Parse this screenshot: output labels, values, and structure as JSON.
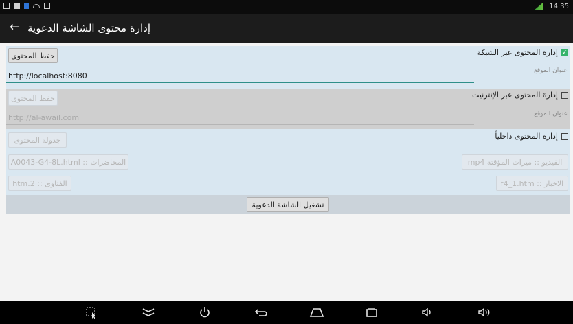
{
  "status_bar": {
    "time": "14:35"
  },
  "header": {
    "back": "←",
    "title": "إدارة محتوى الشاشة الدعوية"
  },
  "network": {
    "checkbox_label": "إدارة المحتوى عبر الشبكة",
    "checked": true,
    "site_hint": "عنوان الموقع",
    "url_value": "http://localhost:8080",
    "save_label": "حفظ المحتوى"
  },
  "internet": {
    "checkbox_label": "إدارة المحتوى عبر الإنترنيت",
    "checked": false,
    "site_hint": "عنوان الموقع",
    "url_value": "http://al-awail.com",
    "save_label": "حفظ المحتوى"
  },
  "internal": {
    "checkbox_label": "إدارة المحتوى داخلياً",
    "checked": false,
    "schedule_label": "جدولة المحتوى",
    "files": {
      "lectures": "المحاضرات :: A0043-G4-8L.html",
      "video": "الفيديو :: ميزات المؤقتة mp4",
      "fatwas": "الفتاوى :: htm.2",
      "news": "الاخبار :: f4_1.htm"
    }
  },
  "run_label": "تشغيل الشاشة الدعوية",
  "colors": {
    "accent": "#35b36b",
    "underline": "#2e8f8a"
  },
  "nav_icons": [
    "screenshot-icon",
    "collapse-icon",
    "power-icon",
    "back-icon",
    "home-icon",
    "recents-icon",
    "volume-down-icon",
    "volume-up-icon"
  ]
}
